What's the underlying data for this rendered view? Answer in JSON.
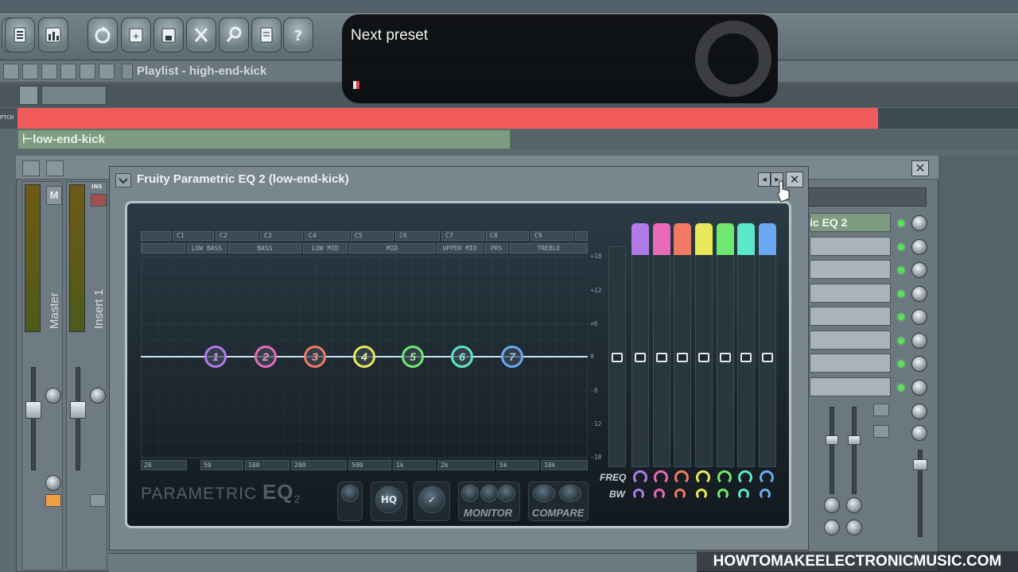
{
  "toolbar": {
    "buttons": [
      "browser-icon",
      "mixer-icon",
      "undo-icon",
      "save-project-icon",
      "save-icon",
      "cut-icon",
      "search-icon",
      "document-icon",
      "help-icon"
    ]
  },
  "playlist": {
    "title": "Playlist - high-end-kick",
    "clip_label": "low-end-kick",
    "left_marker": "PTCH"
  },
  "notification": {
    "title": "Next preset"
  },
  "mixer": {
    "strips": [
      {
        "label": "Master",
        "button": "M"
      },
      {
        "label": "Insert 1",
        "button": "INS"
      }
    ],
    "fx_slot_label": "ic EQ 2"
  },
  "eq_window": {
    "title": "Fruity Parametric EQ 2 (low-end-kick)",
    "close_label": "✕",
    "band_headers": [
      "C1",
      "C2",
      "C3",
      "C4",
      "C5",
      "C6",
      "C7",
      "C8",
      "C9"
    ],
    "band_subheaders": [
      "",
      "LOW BASS",
      "BASS",
      "LOW MID",
      "MID",
      "UPPER MID",
      "PRS",
      "TREBLE"
    ],
    "db_ticks": [
      "+18",
      "+12",
      "+6",
      "0",
      "-6",
      "-12",
      "-18"
    ],
    "freq_ticks": [
      "20",
      "50",
      "100",
      "200",
      "500",
      "1k",
      "2k",
      "5k",
      "10k"
    ],
    "bands": [
      {
        "label": "1",
        "color": "#b07ae8"
      },
      {
        "label": "2",
        "color": "#e86ab8"
      },
      {
        "label": "3",
        "color": "#f07a64"
      },
      {
        "label": "4",
        "color": "#e8e85a"
      },
      {
        "label": "5",
        "color": "#6ee86e"
      },
      {
        "label": "6",
        "color": "#5ae8c8"
      },
      {
        "label": "7",
        "color": "#6aa8f0"
      }
    ],
    "brand_text": "PARAMETRIC",
    "brand_big": "EQ",
    "brand_sub": "2",
    "hq_label": "HQ",
    "monitor_label": "MONITOR",
    "compare_label": "COMPARE",
    "freq_label": "FREQ",
    "bw_label": "BW"
  },
  "watermark": "HOWTOMAKEELECTRONICMUSIC.COM"
}
